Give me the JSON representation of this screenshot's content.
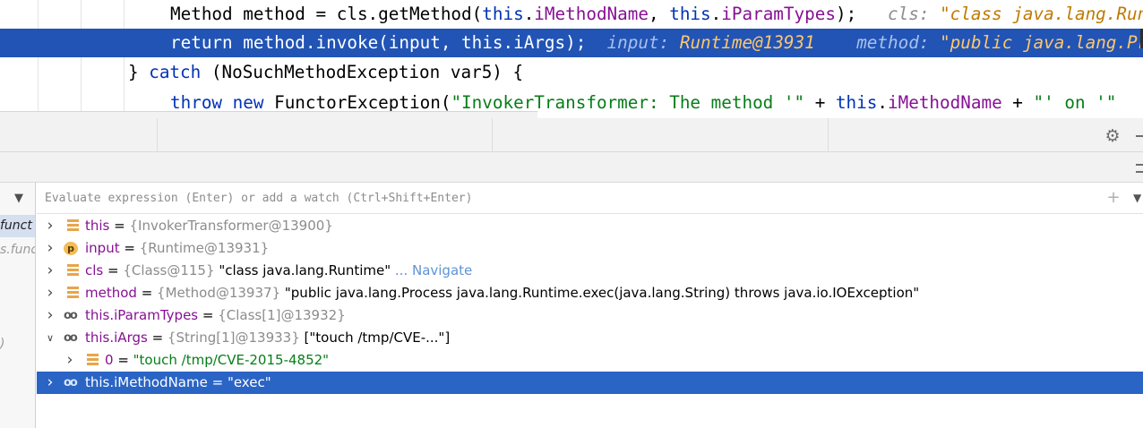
{
  "editor": {
    "lines": [
      {
        "code_parts": [
          {
            "t": "Method method = cls.getMethod(",
            "c": ""
          },
          {
            "t": "this",
            "c": "kw"
          },
          {
            "t": ".",
            "c": ""
          },
          {
            "t": "iMethodName",
            "c": "fld"
          },
          {
            "t": ", ",
            "c": ""
          },
          {
            "t": "this",
            "c": "kw"
          },
          {
            "t": ".",
            "c": ""
          },
          {
            "t": "iParamTypes",
            "c": "fld"
          },
          {
            "t": ");   ",
            "c": ""
          },
          {
            "t": "cls: ",
            "c": "hint"
          },
          {
            "t": "\"class java.lang.Runtime\"",
            "c": "hintv"
          }
        ]
      },
      {
        "code_parts": [
          {
            "t": "return",
            "c": "kw"
          },
          {
            "t": " method.invoke(input, ",
            "c": ""
          },
          {
            "t": "this",
            "c": "kw"
          },
          {
            "t": ".",
            "c": ""
          },
          {
            "t": "iArgs",
            "c": "fld"
          },
          {
            "t": ");  ",
            "c": ""
          },
          {
            "t": "input: ",
            "c": "hint"
          },
          {
            "t": "Runtime@13931",
            "c": "hintv"
          },
          {
            "t": "    ",
            "c": ""
          },
          {
            "t": "method: ",
            "c": "hint"
          },
          {
            "t": "\"public java.lang.Process\"",
            "c": "hintv"
          }
        ]
      },
      {
        "code_parts": [
          {
            "t": "} ",
            "c": ""
          },
          {
            "t": "catch",
            "c": "kw"
          },
          {
            "t": " (NoSuchMethodException var5) {",
            "c": ""
          }
        ]
      },
      {
        "code_parts": [
          {
            "t": "throw new",
            "c": "kw"
          },
          {
            "t": " FunctorException(",
            "c": ""
          },
          {
            "t": "\"InvokerTransformer: The method '\"",
            "c": "str"
          },
          {
            "t": " + ",
            "c": ""
          },
          {
            "t": "this",
            "c": "kw"
          },
          {
            "t": ".",
            "c": ""
          },
          {
            "t": "iMethodName",
            "c": "fld"
          },
          {
            "t": " + ",
            "c": ""
          },
          {
            "t": "\"' on '\"",
            "c": "str"
          }
        ]
      }
    ]
  },
  "debugger": {
    "frames_panel": {
      "items": [
        "funct",
        "s.func",
        ")"
      ]
    },
    "watch": {
      "placeholder": "Evaluate expression (Enter) or add a watch (Ctrl+Shift+Enter)",
      "value": ""
    },
    "variables": [
      {
        "expanded": false,
        "icon": "field",
        "name": "this",
        "type": "{InvokerTransformer@13900}",
        "value": "",
        "link": ""
      },
      {
        "expanded": false,
        "icon": "param",
        "name": "input",
        "type": "{Runtime@13931}",
        "value": "",
        "link": ""
      },
      {
        "expanded": false,
        "icon": "field",
        "name": "cls",
        "type": "{Class@115}",
        "value": "\"class java.lang.Runtime\"",
        "link": "... Navigate"
      },
      {
        "expanded": false,
        "icon": "field",
        "name": "method",
        "type": "{Method@13937}",
        "value": "\"public java.lang.Process java.lang.Runtime.exec(java.lang.String) throws java.io.IOException\"",
        "link": ""
      },
      {
        "expanded": false,
        "icon": "watch",
        "name": "this.iParamTypes",
        "type": "{Class[1]@13932}",
        "value": "",
        "link": ""
      },
      {
        "expanded": true,
        "icon": "watch",
        "name": "this.iArgs",
        "type": "{String[1]@13933}",
        "value": "[\"touch /tmp/CVE-...\"]",
        "link": ""
      },
      {
        "expanded": false,
        "child": true,
        "icon": "field",
        "name": "0",
        "type": "",
        "value": "\"touch /tmp/CVE-2015-4852\"",
        "link": ""
      },
      {
        "expanded": false,
        "icon": "watch",
        "name": "this.iMethodName",
        "type": "",
        "value": "\"exec\"",
        "link": "",
        "selected": true
      }
    ]
  }
}
